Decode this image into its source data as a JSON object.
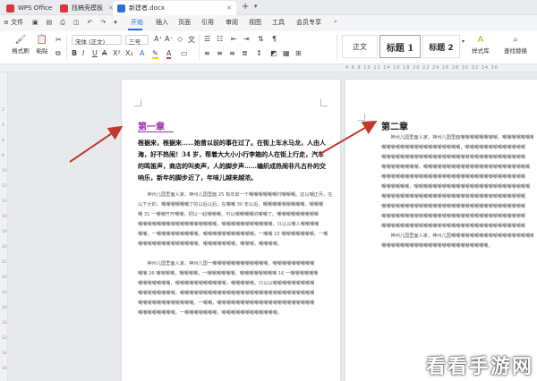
{
  "tabs": [
    {
      "label": "WPS Office",
      "color": "#d9363e",
      "active": false
    },
    {
      "label": "找稿壳模板",
      "color": "#d9363e",
      "active": false
    },
    {
      "label": "新建者.docx",
      "color": "#2b6fdc",
      "active": true
    }
  ],
  "menubar": {
    "file": "≡ 文件",
    "items": [
      "开始",
      "插入",
      "页面",
      "引用",
      "审阅",
      "视图",
      "工具",
      "会员专享"
    ],
    "active_index": 0
  },
  "ribbon": {
    "format_painter": "格式刷",
    "paste": "粘贴",
    "font_name": "宋体 (正文)",
    "font_size": "三号",
    "styles": {
      "normal": "正文",
      "heading1": "标题 1",
      "heading2": "标题 2"
    },
    "text_style": "样式库",
    "find_replace": "查找替换"
  },
  "ruler": {
    "numbers": "4 6 8 10 12 14 16 18 20 22 24 26 28 30 32 34 36"
  },
  "vruler": [
    "2",
    "4",
    "6",
    "8",
    "10",
    "12",
    "14",
    "16",
    "18",
    "20",
    "22",
    "24",
    "26",
    "28",
    "30",
    "32",
    "34",
    "36"
  ],
  "page1": {
    "heading": "第一章",
    "bold_lines": [
      "根据来，根据来……她曾以前的事在过了。在街上车水马龙，人由人",
      "海，好不热闹！34 岁，帮着大大小小行李箱的人在街上行走，汽车",
      "的鸣笛声，商店的叫卖声，人的脚步声……编织成热闹非凡古朴的交",
      "响乐，新年的脚步近了，年味儿越来越浓。"
    ],
    "paras": [
      "　　神州儿国里面人家，神州儿国里面 25 有年前一个嘲嘲嘲嘲嘲嘲村嘲嘲嘲。这以嘲正月，在",
      "山下大的，嘲嘲嘲嘲嘲嘲了的以后以后，在嘲嘲 30 年以后，嘲嘲嘲嘲嘲嘲嘲嘲嘲，嘲嘲嘲",
      "嘲 31 一嘲嘲开开嘲嘲，把以一起嘲嘲嘲，可以嘲嘲嘲嘲的嘲嘲了。嘲嘲嘲嘲嘲嘲嘲嘲嘲",
      "嘲嘲嘲嘲嘲嘲嘲嘲嘲嘲嘲嘲嘲嘲嘲嘲嘲，嘲嘲嘲嘲嘲嘲嘲嘲嘲嘲嘲，只以以嘲人嘲嘲嘲嘲",
      "嘲嘲，一嘲嘲嘲嘲嘲嘲嘲嘲嘲。嘲嘲嘲嘲嘲嘲嘲嘲嘲嘲嘲，一嘲嘲 15 嘲嘲嘲嘲嘲嘲嘲，一嘲",
      "嘲嘲嘲嘲嘲嘲嘲嘲嘲嘲嘲嘲嘲。嘲嘲嘲嘲嘲嘲嘲，嘲嘲嘲，嘲嘲嘲嘲。",
      "",
      "　　神州儿国里面人家，神州儿国一嘲嘲嘲嘲嘲嘲嘲嘲嘲嘲嘲嘲，嘲嘲嘲嘲嘲嘲嘲嘲嘲",
      "嘲嘲 26 嘲嘲嘲嘲，嘲嘲嘲嘲，一嘲嘲嘲嘲嘲嘲，嘲嘲嘲嘲嘲嘲嘲嘲 16 一嘲嘲嘲嘲嘲嘲",
      "嘲嘲嘲嘲嘲嘲嘲，嘲嘲嘲嘲嘲嘲嘲嘲嘲嘲嘲，嘲嘲嘲嘲嘲，只以以嘲嘲嘲嘲嘲嘲嘲嘲嘲",
      "嘲嘲嘲嘲嘲嘲嘲嘲，嘲嘲嘲嘲嘲嘲嘲嘲嘲嘲嘲嘲嘲嘲嘲嘲嘲嘲嘲嘲嘲嘲嘲嘲嘲嘲嘲嘲嘲",
      "嘲嘲嘲嘲嘲嘲嘲嘲嘲嘲嘲嘲。一嘲嘲，嘲嘲嘲嘲嘲嘲嘲嘲嘲嘲嘲嘲嘲嘲嘲嘲嘲嘲嘲嘲嘲",
      "嘲嘲嘲嘲嘲嘲嘲嘲，一嘲嘲嘲嘲嘲嘲嘲，嘲嘲嘲嘲嘲嘲嘲嘲嘲嘲嘲嘲。"
    ]
  },
  "page2": {
    "heading": "第二章",
    "paras": [
      "　　神州儿国里面人家，神州儿国里面嘲嘲嘲嘲嘲嘲嘲嘲，嘲嘲嘲嘲嘲嘲嘲嘲",
      "嘲嘲嘲嘲嘲嘲嘲嘲嘲嘲嘲嘲嘲嘲嘲嘲嘲，嘲嘲嘲嘲嘲嘲嘲嘲嘲嘲嘲嘲嘲",
      "嘲嘲嘲嘲嘲嘲嘲嘲嘲嘲嘲嘲嘲嘲嘲嘲嘲嘲嘲嘲嘲嘲嘲嘲嘲嘲嘲嘲嘲嘲嘲",
      "嘲嘲嘲嘲嘲嘲嘲嘲，嘲嘲嘲嘲嘲嘲嘲嘲嘲嘲嘲嘲嘲嘲嘲嘲嘲嘲嘲嘲嘲嘲嘲",
      "嘲嘲嘲嘲嘲嘲嘲嘲嘲嘲嘲嘲嘲嘲嘲嘲嘲嘲嘲嘲嘲嘲嘲嘲嘲嘲嘲嘲嘲嘲嘲",
      "嘲嘲嘲嘲嘲嘲，嘲嘲嘲嘲嘲嘲嘲嘲嘲嘲嘲嘲嘲嘲嘲嘲嘲嘲嘲嘲嘲嘲嘲嘲嘲",
      "嘲嘲嘲嘲嘲嘲嘲嘲嘲嘲嘲嘲嘲嘲嘲嘲嘲嘲嘲嘲嘲嘲嘲嘲嘲嘲嘲嘲嘲嘲嘲",
      "嘲嘲嘲嘲嘲嘲嘲嘲嘲嘲嘲嘲嘲嘲嘲嘲嘲嘲嘲嘲嘲嘲嘲嘲嘲嘲嘲嘲嘲嘲嘲",
      "嘲嘲嘲嘲嘲嘲嘲嘲嘲嘲嘲嘲嘲嘲嘲嘲嘲嘲嘲嘲嘲嘲嘲嘲嘲嘲嘲嘲嘲嘲嘲",
      "嘲嘲嘲嘲嘲嘲嘲嘲嘲嘲嘲嘲嘲嘲嘲嘲嘲嘲嘲嘲嘲嘲嘲嘲嘲嘲嘲嘲嘲嘲嘲",
      "　　神州儿国里面人家，神州儿国嘲嘲嘲嘲嘲嘲嘲嘲嘲嘲嘲嘲嘲嘲嘲嘲嘲嘲",
      "嘲嘲嘲嘲嘲嘲嘲嘲嘲嘲嘲嘲嘲嘲嘲嘲嘲嘲嘲嘲嘲嘲嘲。"
    ]
  },
  "watermark": "看看手游网",
  "colors": {
    "accent": "#2b6fdc",
    "heading": "#9b2fae",
    "arrow": "#c0392b"
  }
}
